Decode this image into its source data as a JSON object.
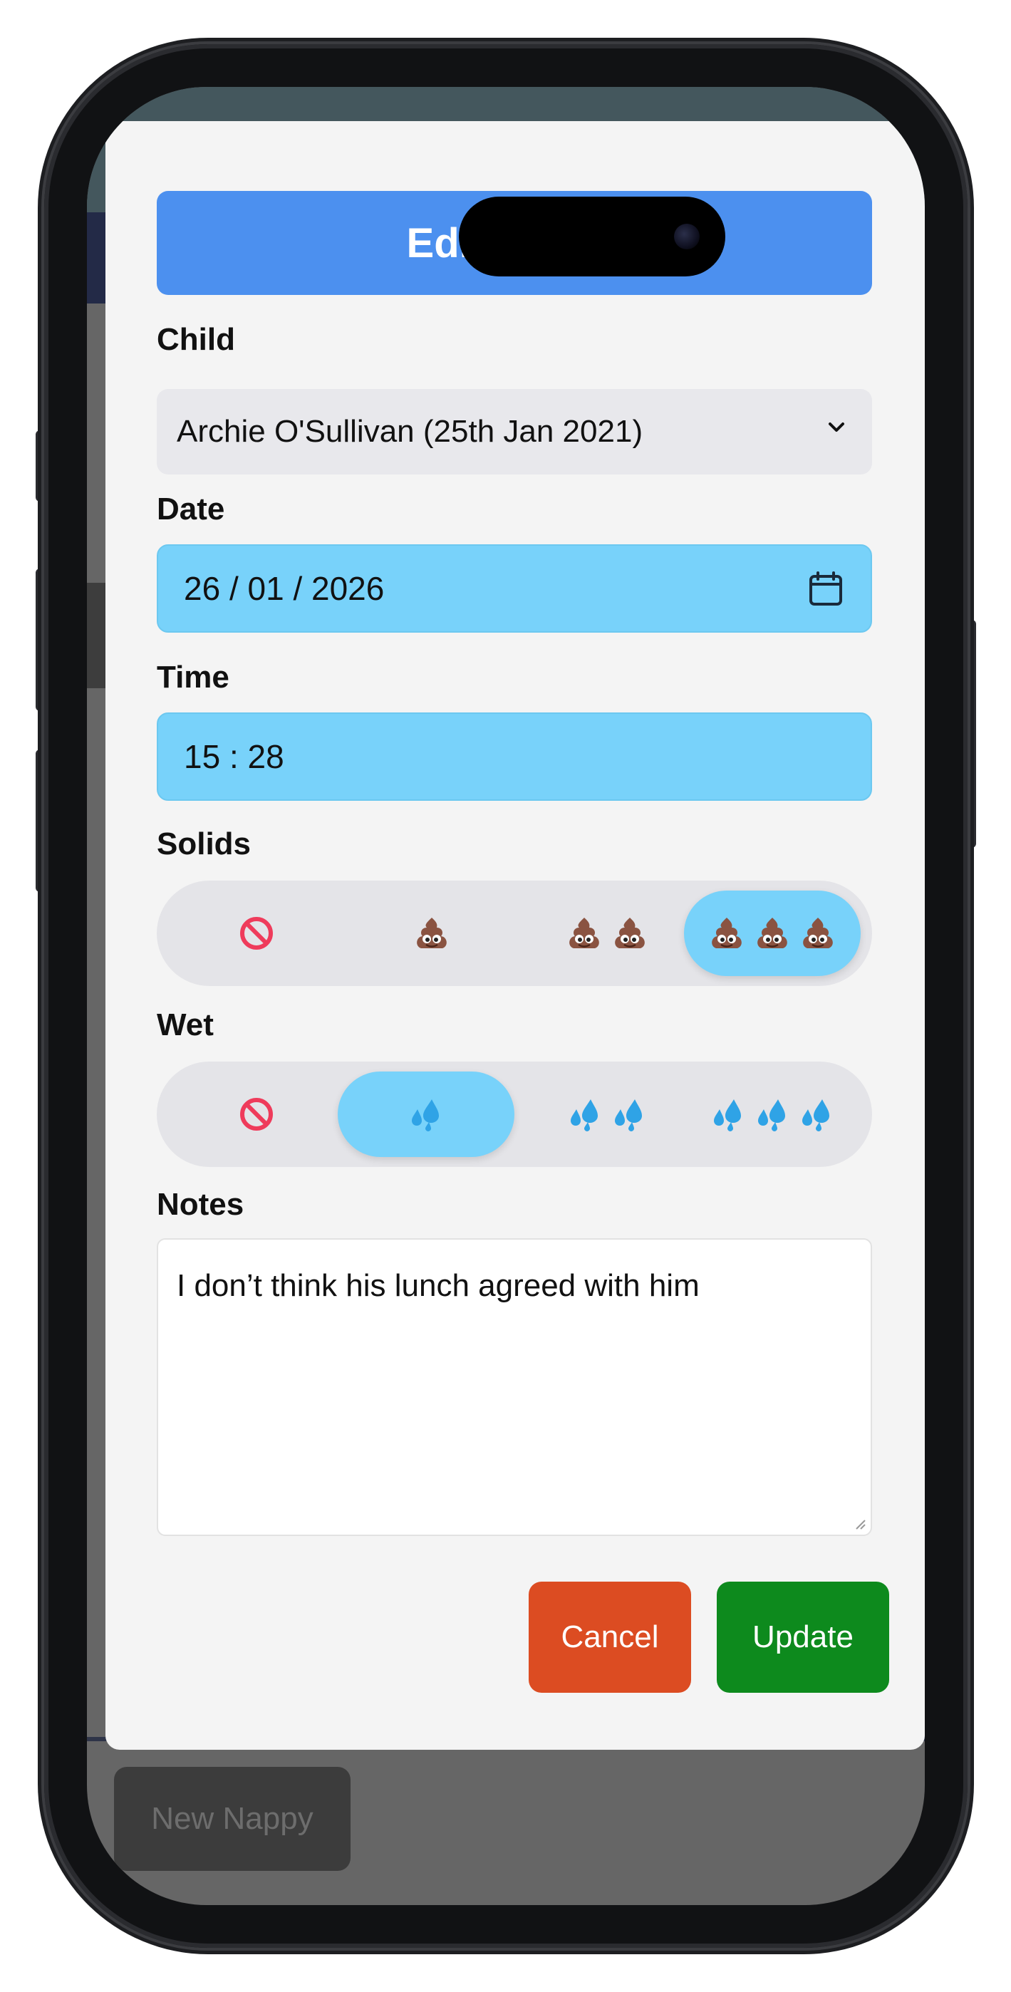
{
  "modal": {
    "title": "Edit Nappy",
    "child": {
      "label": "Child",
      "selected": "Archie O'Sullivan (25th Jan 2021)"
    },
    "date": {
      "label": "Date",
      "value": "26 / 01 / 2026"
    },
    "time": {
      "label": "Time",
      "value": "15 : 28"
    },
    "solids": {
      "label": "Solids",
      "options": [
        "none-icon",
        "poo-icon x1",
        "poo-icon x2",
        "poo-icon x3"
      ],
      "selected_index": 3
    },
    "wet": {
      "label": "Wet",
      "options": [
        "none-icon",
        "droplets-icon x1",
        "droplets-icon x2",
        "droplets-icon x3"
      ],
      "selected_index": 1
    },
    "notes": {
      "label": "Notes",
      "value": "I don’t think his lunch agreed with him"
    },
    "cancel_label": "Cancel",
    "update_label": "Update"
  },
  "background": {
    "new_nappy_label": "New Nappy"
  },
  "colors": {
    "title_bar": "#4c90ef",
    "input_highlight": "#78d2fa",
    "cancel": "#dc4c22",
    "update": "#0d8a1d"
  }
}
